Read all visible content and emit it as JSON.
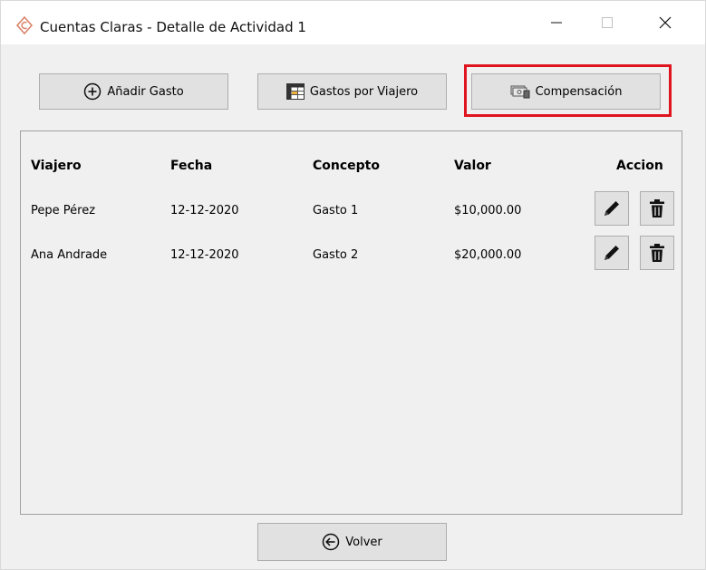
{
  "window": {
    "title": "Cuentas Claras - Detalle de Actividad 1"
  },
  "toolbar": {
    "add_label": "Añadir Gasto",
    "gastos_viajero_label": "Gastos por Viajero",
    "compensacion_label": "Compensación"
  },
  "table": {
    "headers": {
      "viajero": "Viajero",
      "fecha": "Fecha",
      "concepto": "Concepto",
      "valor": "Valor",
      "accion": "Accion"
    },
    "rows": [
      {
        "viajero": "Pepe Pérez",
        "fecha": "12-12-2020",
        "concepto": "Gasto 1",
        "valor": "$10,000.00"
      },
      {
        "viajero": "Ana Andrade",
        "fecha": "12-12-2020",
        "concepto": "Gasto 2",
        "valor": "$20,000.00"
      }
    ]
  },
  "footer": {
    "volver_label": "Volver"
  },
  "colors": {
    "highlight": "#e0141e",
    "button_bg": "#e1e1e1",
    "window_bg": "#f0f0f0"
  },
  "icons": [
    "app-logo-icon",
    "add-circle-icon",
    "table-icon",
    "money-icon",
    "edit-pencil-icon",
    "trash-icon",
    "back-arrow-icon"
  ]
}
